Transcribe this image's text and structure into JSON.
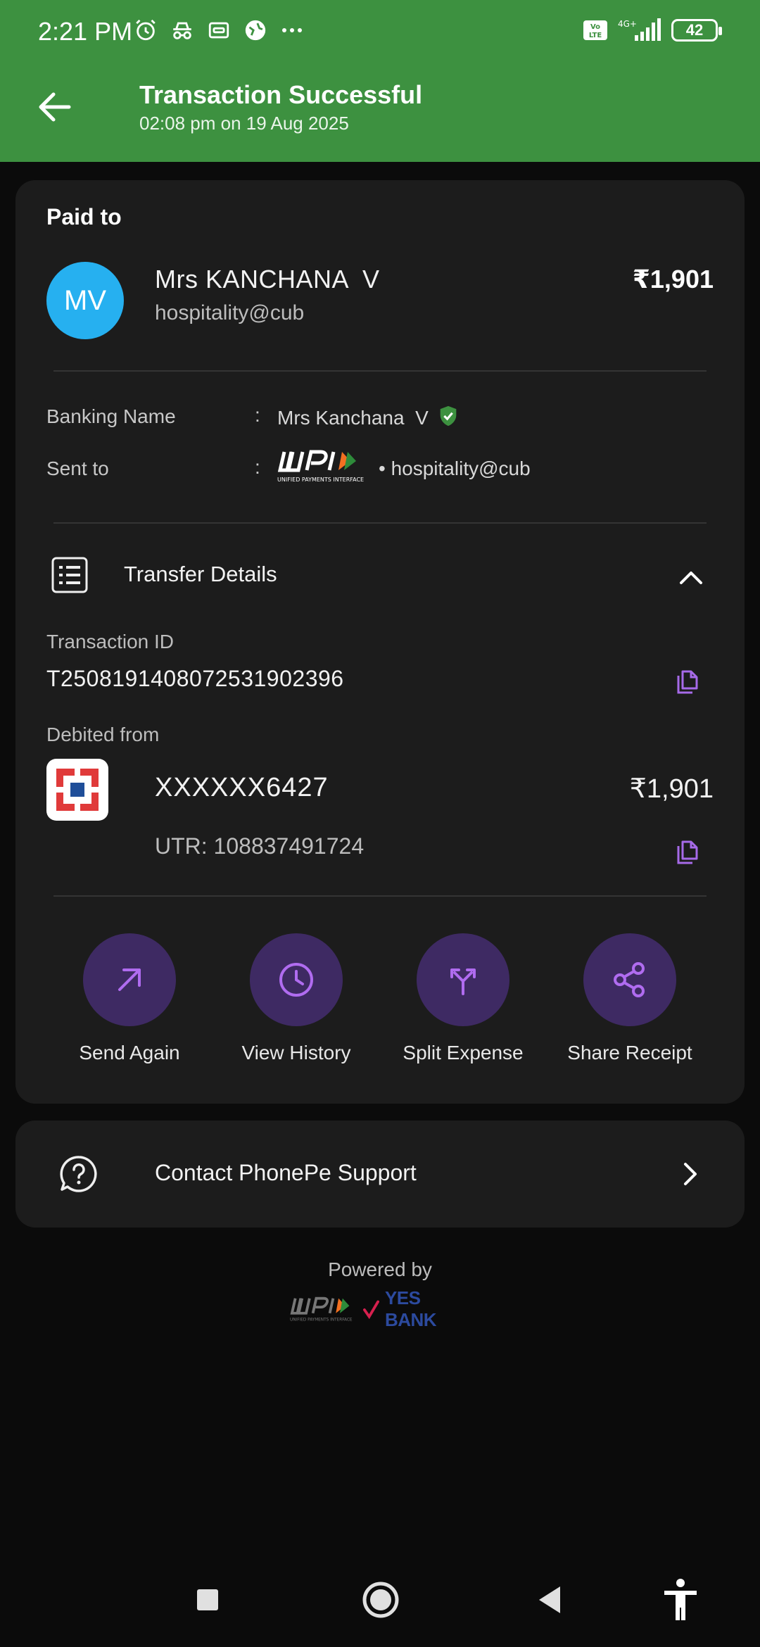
{
  "status_bar": {
    "time": "2:21 PM",
    "battery": "42",
    "network": "4G+",
    "volte": "Vo LTE"
  },
  "header": {
    "title": "Transaction Successful",
    "subtitle": "02:08 pm on 19 Aug 2025",
    "accent_color": "#3d9140"
  },
  "payment": {
    "paid_to_label": "Paid to",
    "avatar_initials": "MV",
    "avatar_color": "#26b0f0",
    "payee_name": "Mrs KANCHANA  V",
    "payee_vpa": "hospitality@cub",
    "amount": "₹1,901"
  },
  "info": {
    "banking_name_label": "Banking Name",
    "banking_name_value": "Mrs Kanchana  V",
    "sent_to_label": "Sent to",
    "sent_to_value": "• hospitality@cub",
    "colon": ":"
  },
  "transfer_details": {
    "title": "Transfer Details",
    "transaction_id_label": "Transaction ID",
    "transaction_id": "T2508191408072531902396",
    "debited_from_label": "Debited from",
    "account": "XXXXXX6427",
    "debit_amount": "₹1,901",
    "utr": "UTR: 108837491724"
  },
  "actions": [
    {
      "label": "Send Again",
      "icon": "arrow-up-right-icon"
    },
    {
      "label": "View History",
      "icon": "clock-icon"
    },
    {
      "label": "Split Expense",
      "icon": "split-icon"
    },
    {
      "label": "Share Receipt",
      "icon": "share-icon"
    }
  ],
  "support": {
    "label": "Contact PhonePe Support"
  },
  "footer": {
    "powered_by": "Powered by",
    "bank": "YES BANK"
  },
  "colors": {
    "action_circle": "#3e2a63",
    "action_icon": "#b06cf0",
    "copy_icon": "#a66ae8"
  }
}
